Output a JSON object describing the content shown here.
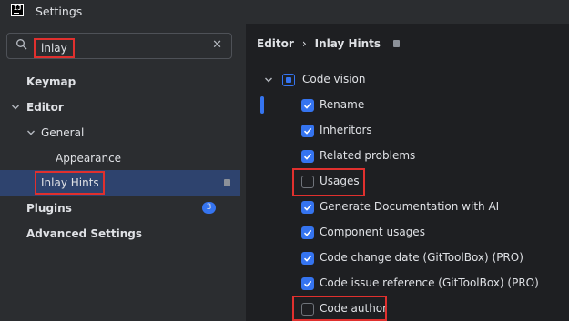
{
  "window": {
    "title": "Settings",
    "icon": "intellij-app-icon"
  },
  "search": {
    "value": "inlay",
    "icon": "search-icon",
    "clear_icon": "close-icon"
  },
  "tree": {
    "keymap": "Keymap",
    "editor": "Editor",
    "general": "General",
    "appearance": "Appearance",
    "inlay_hints": "Inlay Hints",
    "plugins": "Plugins",
    "plugins_badge": "3",
    "advanced": "Advanced Settings"
  },
  "breadcrumb": {
    "parent": "Editor",
    "separator": "›",
    "current": "Inlay Hints"
  },
  "code_vision": {
    "group_label": "Code vision",
    "items": [
      {
        "label": "Rename",
        "checked": true
      },
      {
        "label": "Inheritors",
        "checked": true
      },
      {
        "label": "Related problems",
        "checked": true
      },
      {
        "label": "Usages",
        "checked": false
      },
      {
        "label": "Generate Documentation with AI",
        "checked": true
      },
      {
        "label": "Component usages",
        "checked": true
      },
      {
        "label": "Code change date (GitToolBox) (PRO)",
        "checked": true
      },
      {
        "label": "Code issue reference (GitToolBox) (PRO)",
        "checked": true
      },
      {
        "label": "Code author",
        "checked": false
      }
    ]
  },
  "colors": {
    "accent": "#3574f0",
    "highlight": "#e0302e",
    "selection": "#2e436e"
  }
}
